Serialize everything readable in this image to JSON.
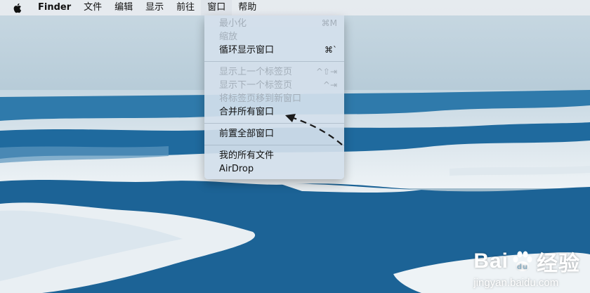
{
  "menubar": {
    "apple_icon": "apple-logo-icon",
    "items": [
      "Finder",
      "文件",
      "编辑",
      "显示",
      "前往",
      "窗口",
      "帮助"
    ],
    "active": "窗口"
  },
  "window_menu": {
    "items": [
      {
        "label": "最小化",
        "shortcut": "⌘M",
        "enabled": false
      },
      {
        "label": "缩放",
        "shortcut": "",
        "enabled": false
      },
      {
        "label": "循环显示窗口",
        "shortcut": "⌘`",
        "enabled": true
      },
      {
        "label": "显示上一个标签页",
        "shortcut": "^⇧⇥",
        "enabled": false
      },
      {
        "label": "显示下一个标签页",
        "shortcut": "^⇥",
        "enabled": false
      },
      {
        "label": "将标签页移到新窗口",
        "shortcut": "",
        "enabled": false
      },
      {
        "label": "合并所有窗口",
        "shortcut": "",
        "enabled": true
      },
      {
        "label": "前置全部窗口",
        "shortcut": "",
        "enabled": true
      },
      {
        "label": "我的所有文件",
        "shortcut": "",
        "enabled": true
      },
      {
        "label": "AirDrop",
        "shortcut": "",
        "enabled": true
      }
    ]
  },
  "annotation": {
    "arrow_color": "#1a1a1a",
    "points_to": "合并所有窗口"
  },
  "watermark": {
    "brand_a": "Bai",
    "brand_b": "经验",
    "url": "jingyan.baidu.com"
  },
  "colors": {
    "sky": "#a9c1cf",
    "ice": "#e6edf2",
    "water": "#1f6a9e",
    "deep_water": "#1a5c8c"
  }
}
